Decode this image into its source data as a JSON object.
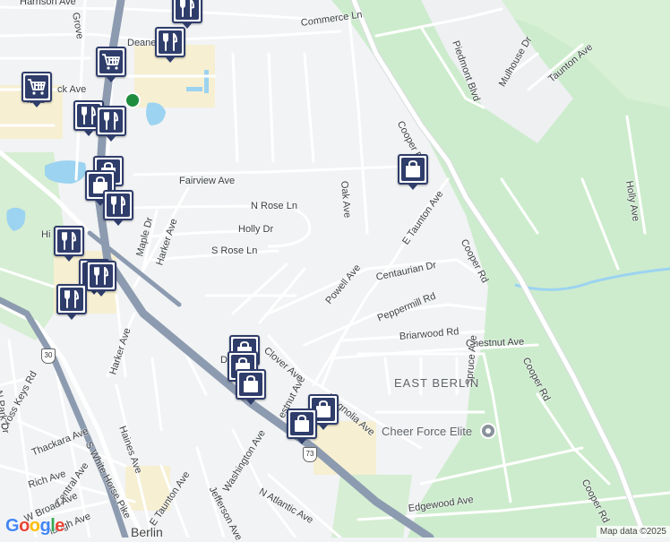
{
  "map": {
    "area_label": "EAST BERLIN",
    "town_label": "Berlin",
    "poi": "Cheer Force Elite",
    "footer": {
      "logo": "Google",
      "attribution": "Map data ©2025"
    },
    "route_shields": [
      "30",
      "73"
    ],
    "streets": {
      "harrison": "Harrison Ave",
      "commerce": "Commerce Ln",
      "deane": "Deane",
      "ck": "ck Ave",
      "fairview": "Fairview Ave",
      "nrose": "N Rose Ln",
      "holly_dr": "Holly Dr",
      "srose": "S Rose Ln",
      "maple": "Maple Dr",
      "harker1": "Harker Ave",
      "harker2": "Harker Ave",
      "oak": "Oak Ave",
      "powell": "Powell Ave",
      "etaunton1": "E Taunton Ave",
      "etaunton2": "E Taunton Ave",
      "centaurian": "Centaurian Dr",
      "peppermill": "Peppermill Rd",
      "briarwood": "Briarwood Rd",
      "chestnut1": "Chestnut Ave",
      "chestnut2": "estnut Ave",
      "clover": "Clover Ave",
      "magnolia": "Magnolia Ave",
      "spruce": "Spruce Ave",
      "cooper1": "Cooper Rd",
      "cooper2": "Cooper Rd",
      "cooper3": "Cooper Rd",
      "cooper4": "Cooper Rd",
      "piedmont": "Piedmont Blvd",
      "mulhouse": "Mulhouse Dr",
      "taunton": "Taunton Ave",
      "hollyave": "Holly Ave",
      "haines": "Haines Ave",
      "thackara": "Thackara Ave",
      "rich": "Rich Ave",
      "central": "Central Ave",
      "wbroad": "W Broad Ave",
      "laugh": "laugh Ave",
      "whitehorse": "S White Horse Pike",
      "crosskeys": "Cross Keys Rd",
      "npark": "N Park Dr",
      "washington": "Washington Ave",
      "jefferson": "Jefferson Ave",
      "natlantic": "N Atlantic Ave",
      "edgewood": "Edgewood Ave",
      "grove": "Grove",
      "d": "D",
      "hi": "Hi"
    },
    "markers": [
      {
        "type": "restaurant",
        "icon": "restaurant-icon"
      },
      {
        "type": "restaurant",
        "icon": "restaurant-icon"
      },
      {
        "type": "grocery",
        "icon": "shopping-cart-icon"
      },
      {
        "type": "grocery",
        "icon": "shopping-cart-icon"
      },
      {
        "type": "restaurant",
        "icon": "restaurant-icon"
      },
      {
        "type": "restaurant",
        "icon": "restaurant-icon"
      },
      {
        "type": "shopping",
        "icon": "shopping-bag-icon"
      },
      {
        "type": "shopping",
        "icon": "shopping-bag-icon"
      },
      {
        "type": "restaurant",
        "icon": "restaurant-icon"
      },
      {
        "type": "restaurant",
        "icon": "restaurant-icon"
      },
      {
        "type": "restaurant",
        "icon": "restaurant-icon"
      },
      {
        "type": "restaurant",
        "icon": "restaurant-icon"
      },
      {
        "type": "shopping",
        "icon": "shopping-bag-icon"
      },
      {
        "type": "restaurant",
        "icon": "restaurant-icon"
      },
      {
        "type": "shopping",
        "icon": "shopping-bag-icon"
      },
      {
        "type": "shopping",
        "icon": "shopping-bag-icon"
      },
      {
        "type": "shopping",
        "icon": "shopping-bag-icon"
      },
      {
        "type": "shopping",
        "icon": "shopping-bag-icon"
      },
      {
        "type": "shopping",
        "icon": "shopping-bag-icon"
      }
    ],
    "colors": {
      "park": "#cdeccd",
      "water": "#9cd3f0",
      "highway": "#8d9bb0",
      "marker": "#2f3d6b",
      "commercial": "#f6efd2"
    }
  }
}
